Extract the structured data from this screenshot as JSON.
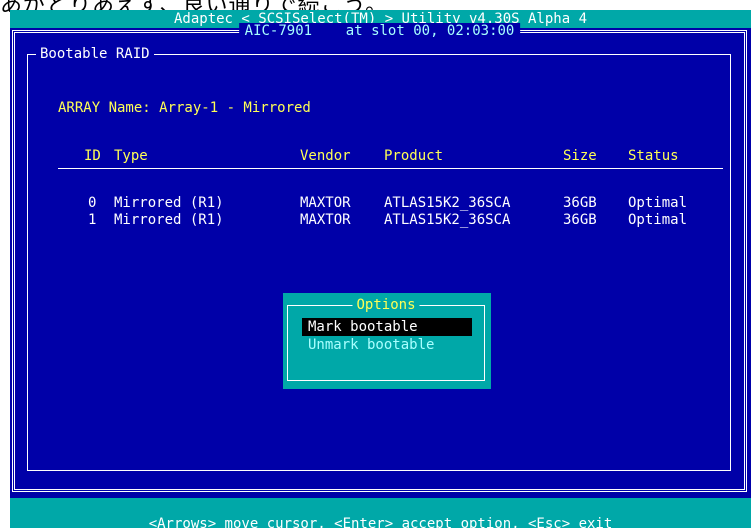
{
  "caption": "あがとりあえず、良い通りで続こう。",
  "title_bar": "Adaptec < SCSISelect(TM) > Utility v4.30S Alpha 4",
  "adapter_caption": "AIC-7901    at slot 00, 02:03:00",
  "panel_title": "Bootable RAID",
  "array_label": "ARRAY Name: Array-1 - Mirrored",
  "columns": {
    "id": "ID",
    "type": "Type",
    "vendor": "Vendor",
    "product": "Product",
    "size": "Size",
    "status": "Status"
  },
  "rows": [
    {
      "id": "0",
      "type": "Mirrored (R1)",
      "vendor": "MAXTOR",
      "product": "ATLAS15K2_36SCA",
      "size": "36GB",
      "status": "Optimal"
    },
    {
      "id": "1",
      "type": "Mirrored (R1)",
      "vendor": "MAXTOR",
      "product": "ATLAS15K2_36SCA",
      "size": "36GB",
      "status": "Optimal"
    }
  ],
  "options": {
    "title": "Options",
    "items": [
      {
        "label": "Mark bootable",
        "state": "selected"
      },
      {
        "label": "Unmark bootable",
        "state": "disabled"
      }
    ]
  },
  "status_bar": "<Arrows> move cursor, <Enter> accept option, <Esc> exit",
  "colors": {
    "background": "#0000a8",
    "title_bar": "#00a8a8",
    "heading_text": "#ffff55",
    "body_text": "#ffffff",
    "highlight_bg": "#000000"
  }
}
